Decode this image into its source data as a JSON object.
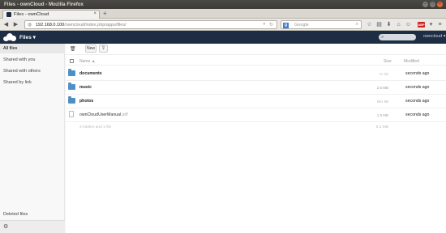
{
  "window": {
    "title": "Files - ownCloud - Mozilla Firefox"
  },
  "browser": {
    "tab_label": "Files - ownCloud",
    "url_host": "192.168.0.100",
    "url_path": "/owncloud/index.php/apps/files/",
    "search_placeholder": "Google"
  },
  "header": {
    "app_title": "Files ▾",
    "search_placeholder": "",
    "user": "owncloud ▾"
  },
  "sidebar": {
    "items": [
      {
        "label": "All files"
      },
      {
        "label": "Shared with you"
      },
      {
        "label": "Shared with others"
      },
      {
        "label": "Shared by link"
      }
    ],
    "deleted_files": "Deleted files"
  },
  "toolbar": {
    "new_label": "New"
  },
  "table": {
    "col_name": "Name",
    "col_size": "Size",
    "col_modified": "Modified",
    "rows": [
      {
        "name": "documents",
        "ext": "",
        "size": "22 kB",
        "size_color": "#c4c4c4",
        "modified": "seconds ago",
        "type": "folder"
      },
      {
        "name": "music",
        "ext": "",
        "size": "2.6 MB",
        "size_color": "#9a9a9a",
        "modified": "seconds ago",
        "type": "folder"
      },
      {
        "name": "photos",
        "ext": "",
        "size": "661 kB",
        "size_color": "#b4b4b4",
        "modified": "seconds ago",
        "type": "folder"
      },
      {
        "name": "ownCloudUserManual",
        "ext": ".pdf",
        "size": "1.9 MB",
        "size_color": "#a3a3a3",
        "modified": "seconds ago",
        "type": "file"
      }
    ],
    "summary": "3 folders and 1 file",
    "summary_size": "5.3 MB"
  },
  "colors": {
    "header_bg": "#1d2d44",
    "folder": "#4f8fc7"
  }
}
